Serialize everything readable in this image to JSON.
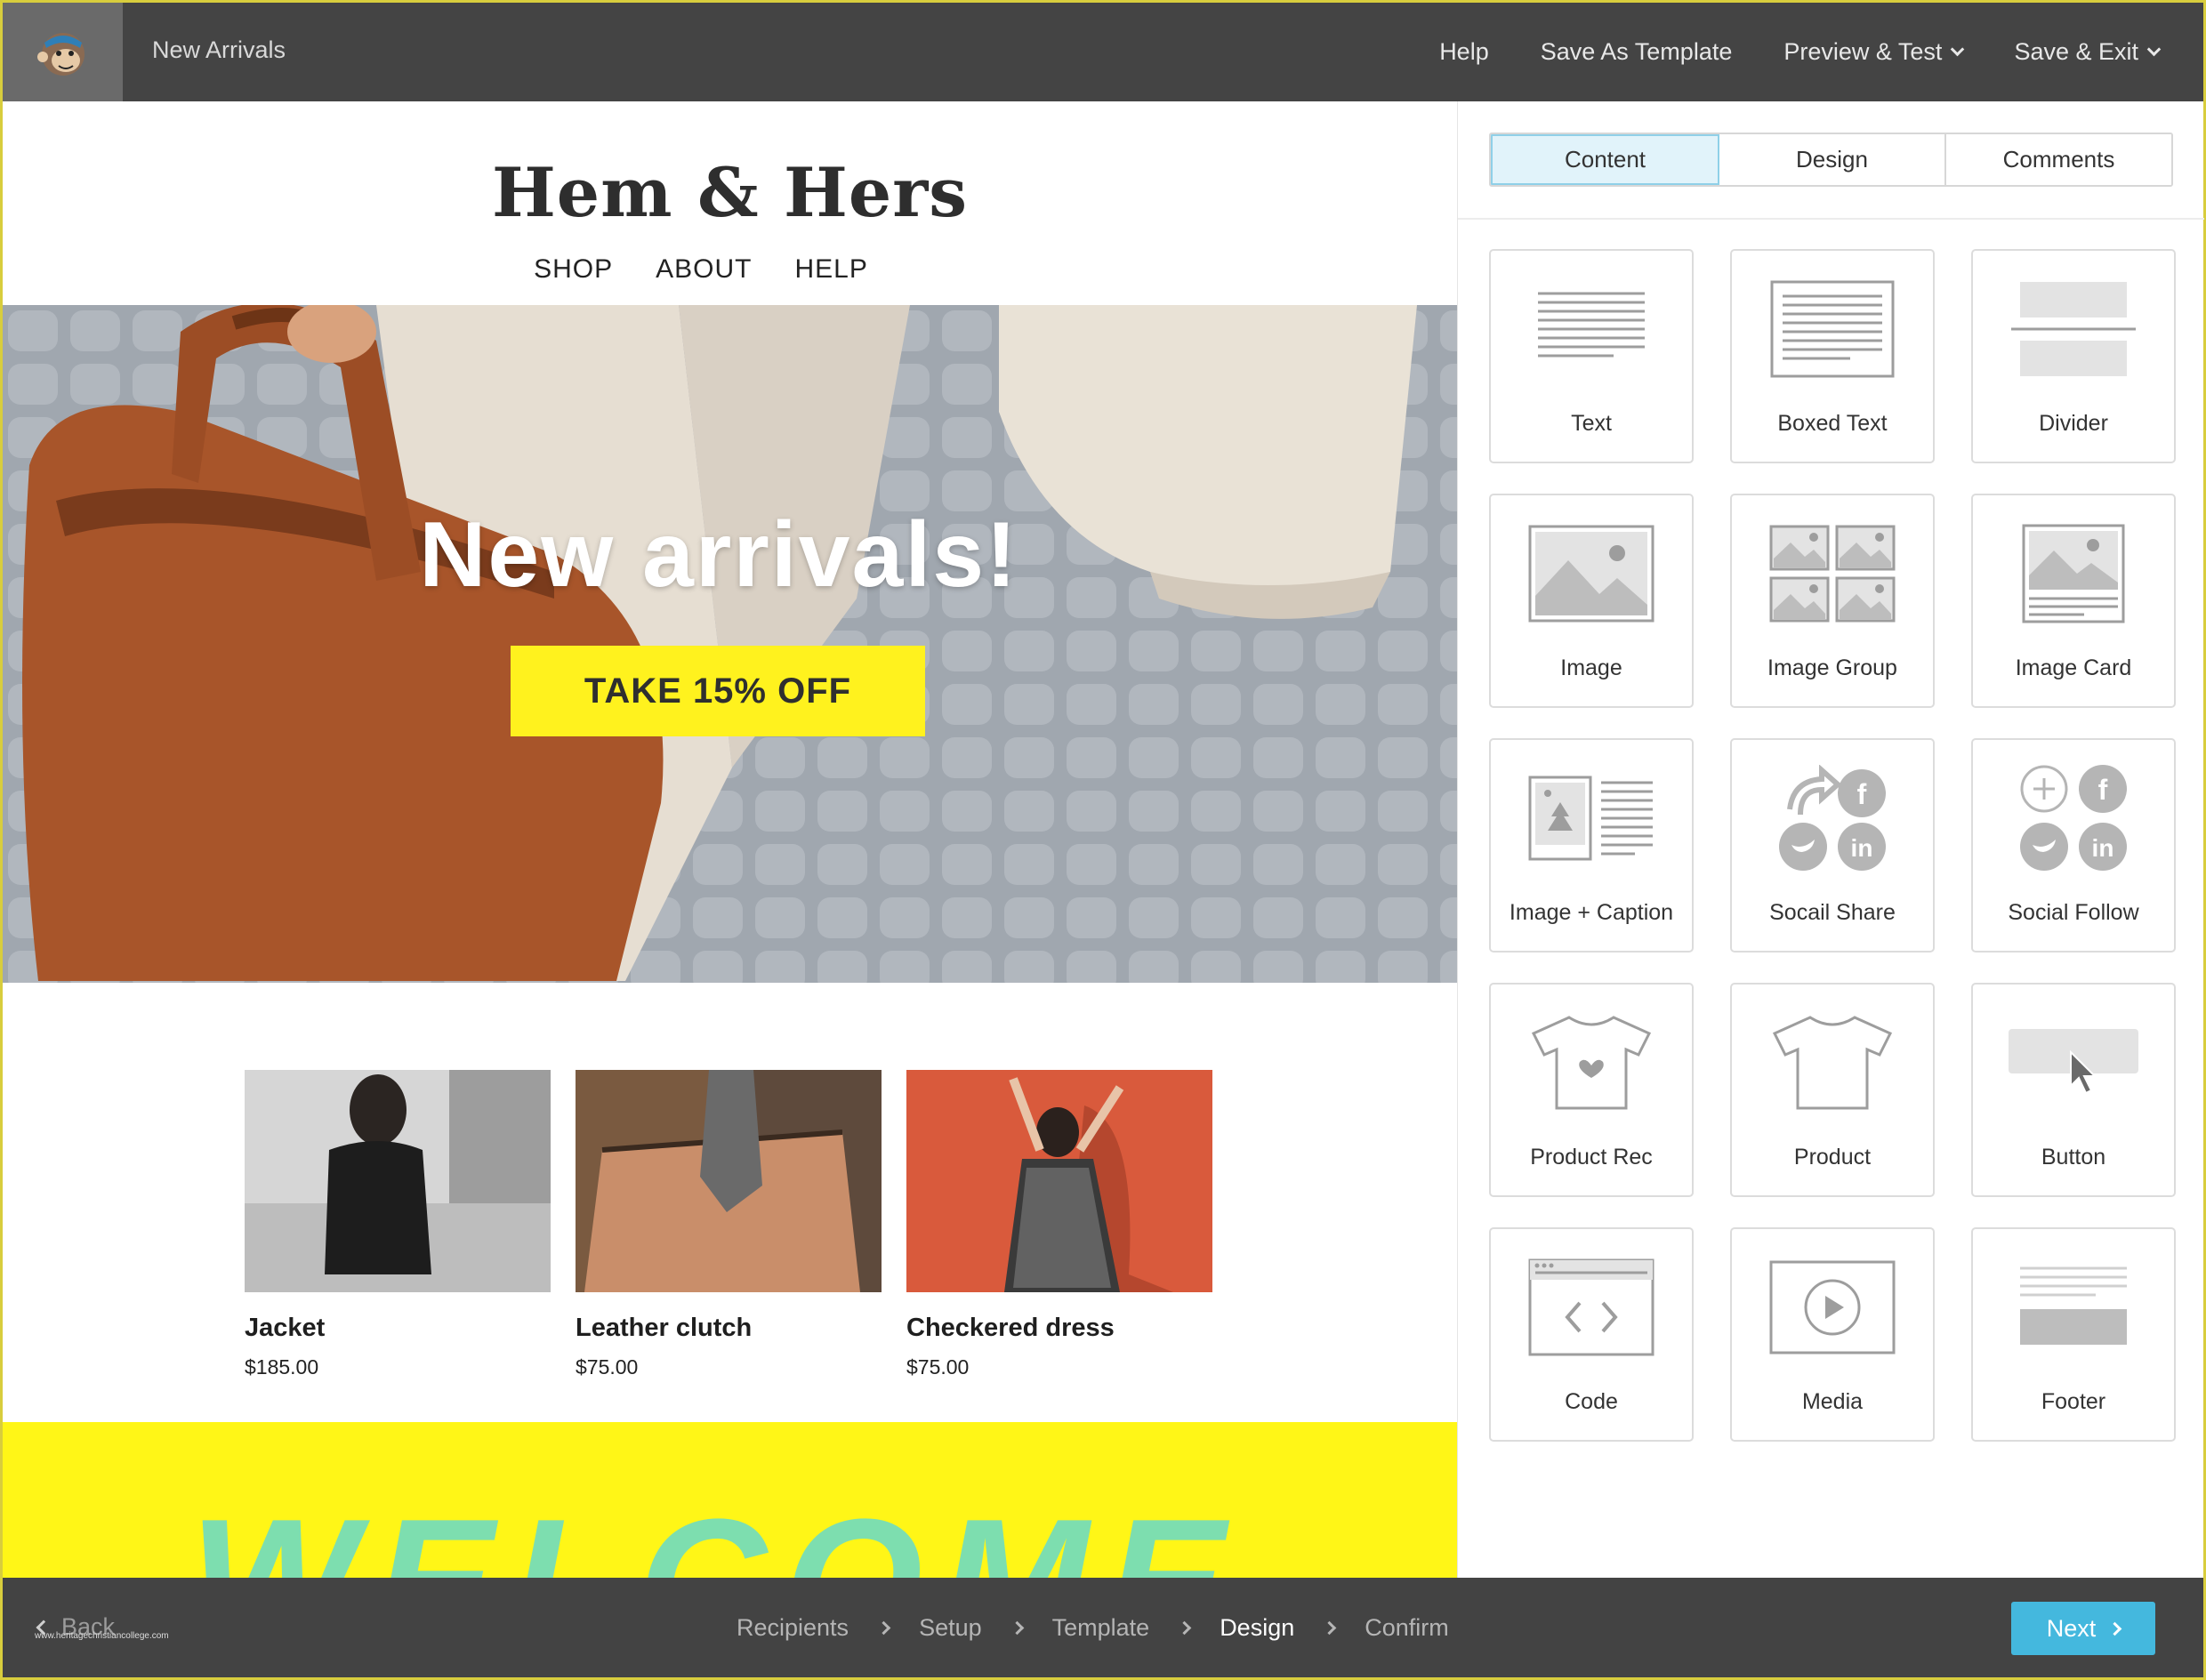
{
  "topbar": {
    "logo_icon": "mailchimp-monkey-icon",
    "campaign_title": "New Arrivals",
    "nav": [
      {
        "label": "Help",
        "has_dropdown": false
      },
      {
        "label": "Save As Template",
        "has_dropdown": false
      },
      {
        "label": "Preview & Test",
        "has_dropdown": true
      },
      {
        "label": "Save & Exit",
        "has_dropdown": true
      }
    ]
  },
  "email": {
    "brand": "Hem & Hers",
    "nav": [
      "SHOP",
      "ABOUT",
      "HELP"
    ],
    "hero": {
      "headline": "New arrivals!",
      "cta": "TAKE 15% OFF",
      "cta_color": "#fff21e"
    },
    "products": [
      {
        "name": "Jacket",
        "price": "$185.00"
      },
      {
        "name": "Leather clutch",
        "price": "$75.00"
      },
      {
        "name": "Checkered dress",
        "price": "$75.00"
      }
    ],
    "welcome_band_text": "WELCOME",
    "welcome_band_color": "#fff617"
  },
  "panel": {
    "tabs": [
      {
        "label": "Content",
        "active": true
      },
      {
        "label": "Design",
        "active": false
      },
      {
        "label": "Comments",
        "active": false
      }
    ],
    "blocks": [
      {
        "label": "Text",
        "icon": "text-block-icon"
      },
      {
        "label": "Boxed Text",
        "icon": "boxed-text-block-icon"
      },
      {
        "label": "Divider",
        "icon": "divider-block-icon"
      },
      {
        "label": "Image",
        "icon": "image-block-icon"
      },
      {
        "label": "Image Group",
        "icon": "image-group-block-icon"
      },
      {
        "label": "Image Card",
        "icon": "image-card-block-icon"
      },
      {
        "label": "Image + Caption",
        "icon": "image-caption-block-icon"
      },
      {
        "label": "Socail Share",
        "icon": "social-share-block-icon"
      },
      {
        "label": "Social Follow",
        "icon": "social-follow-block-icon"
      },
      {
        "label": "Product Rec",
        "icon": "product-rec-block-icon"
      },
      {
        "label": "Product",
        "icon": "product-block-icon"
      },
      {
        "label": "Button",
        "icon": "button-block-icon"
      },
      {
        "label": "Code",
        "icon": "code-block-icon"
      },
      {
        "label": "Media",
        "icon": "media-block-icon"
      },
      {
        "label": "Footer",
        "icon": "footer-block-icon"
      }
    ]
  },
  "bottombar": {
    "back_label": "Back",
    "watermark": "www.heritagechristiancollege.com",
    "steps": [
      {
        "label": "Recipients",
        "current": false
      },
      {
        "label": "Setup",
        "current": false
      },
      {
        "label": "Template",
        "current": false
      },
      {
        "label": "Design",
        "current": true
      },
      {
        "label": "Confirm",
        "current": false
      }
    ],
    "next_label": "Next",
    "next_color": "#44b8de"
  }
}
